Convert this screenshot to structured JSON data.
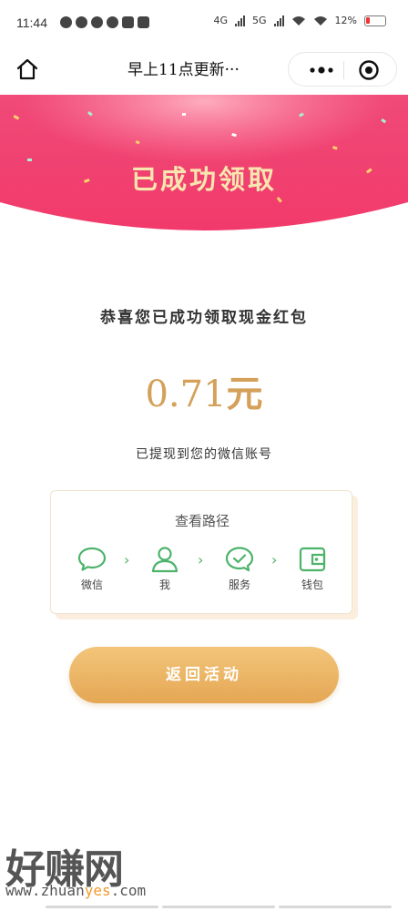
{
  "status_bar": {
    "time": "11:44",
    "network_4g": "4G",
    "network_5g": "5G",
    "battery_percent": "12%"
  },
  "nav": {
    "title": "早上11点更新···",
    "home_icon": "home-icon",
    "more_icon": "more-dots-icon",
    "close_icon": "target-close-icon"
  },
  "banner": {
    "title": "已成功领取",
    "color": "#f2477a"
  },
  "result": {
    "congrats": "恭喜您已成功领取现金红包",
    "amount": "0.71",
    "unit": "元",
    "withdrawn_note": "已提现到您的微信账号",
    "amount_color": "#d4a05a"
  },
  "path_card": {
    "title": "查看路径",
    "steps": [
      {
        "label": "微信",
        "icon": "chat-bubble-icon"
      },
      {
        "label": "我",
        "icon": "user-icon"
      },
      {
        "label": "服务",
        "icon": "check-circle-icon"
      },
      {
        "label": "钱包",
        "icon": "wallet-icon"
      }
    ],
    "separator": "›",
    "icon_color": "#4cb36b"
  },
  "return_button": {
    "label": "返回活动"
  },
  "watermark": {
    "brand": "好赚网",
    "url_prefix": "www.zhuan",
    "url_highlight": "yes",
    "url_suffix": ".com"
  }
}
